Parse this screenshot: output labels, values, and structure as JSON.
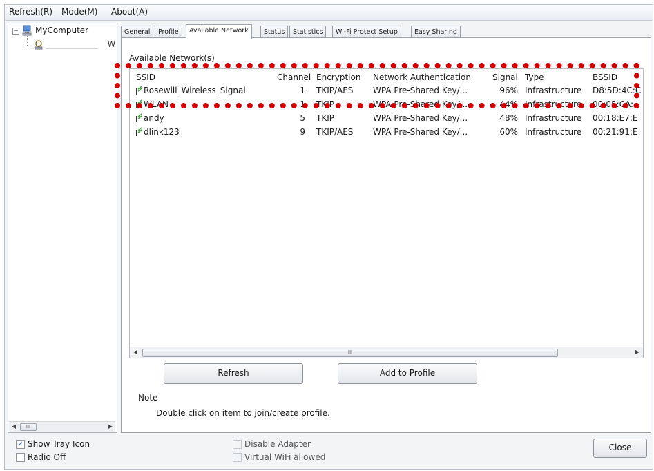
{
  "menubar": {
    "items": [
      "Refresh(R)",
      "Mode(M)",
      "About(A)"
    ]
  },
  "tree": {
    "root_label": "MyComputer",
    "root_expander": "−",
    "child_label": "W"
  },
  "tabs": [
    "General",
    "Profile",
    "Available Network",
    "Status",
    "Statistics",
    "Wi-Fi Protect Setup",
    "Easy Sharing"
  ],
  "available_network": {
    "group_title": "Available Network(s)",
    "columns": [
      "SSID",
      "Channel",
      "Encryption",
      "Network Authentication",
      "Signal",
      "Type",
      "BSSID"
    ],
    "rows": [
      {
        "ssid": "Rosewill_Wireless_Signal",
        "channel": "1",
        "encryption": "TKIP/AES",
        "auth": "WPA Pre-Shared Key/...",
        "signal": "96%",
        "type": "Infrastructure",
        "bssid": "D8:5D:4C:C"
      },
      {
        "ssid": "WLAN",
        "channel": "1",
        "encryption": "TKIP",
        "auth": "WPA Pre-Shared Key/...",
        "signal": "44%",
        "type": "Infrastructure",
        "bssid": "00:05:CA:"
      },
      {
        "ssid": "andy",
        "channel": "5",
        "encryption": "TKIP",
        "auth": "WPA Pre-Shared Key/...",
        "signal": "48%",
        "type": "Infrastructure",
        "bssid": "00:18:E7:E"
      },
      {
        "ssid": "dlink123",
        "channel": "9",
        "encryption": "TKIP/AES",
        "auth": "WPA Pre-Shared Key/...",
        "signal": "60%",
        "type": "Infrastructure",
        "bssid": "00:21:91:E"
      }
    ],
    "scroll_thumb": "III",
    "refresh_label": "Refresh",
    "add_profile_label": "Add to Profile",
    "note_label": "Note",
    "note_text": "Double click on item to join/create profile."
  },
  "bottom": {
    "show_tray_icon": "Show Tray Icon",
    "radio_off": "Radio Off",
    "disable_adapter": "Disable Adapter",
    "virtual_wifi": "Virtual WiFi allowed",
    "close_label": "Close",
    "check_mark": "✓"
  },
  "tree_scroll_thumb": "III",
  "colors": {
    "highlight_dots": "#d00000",
    "signal_green": "#3aa23a"
  }
}
